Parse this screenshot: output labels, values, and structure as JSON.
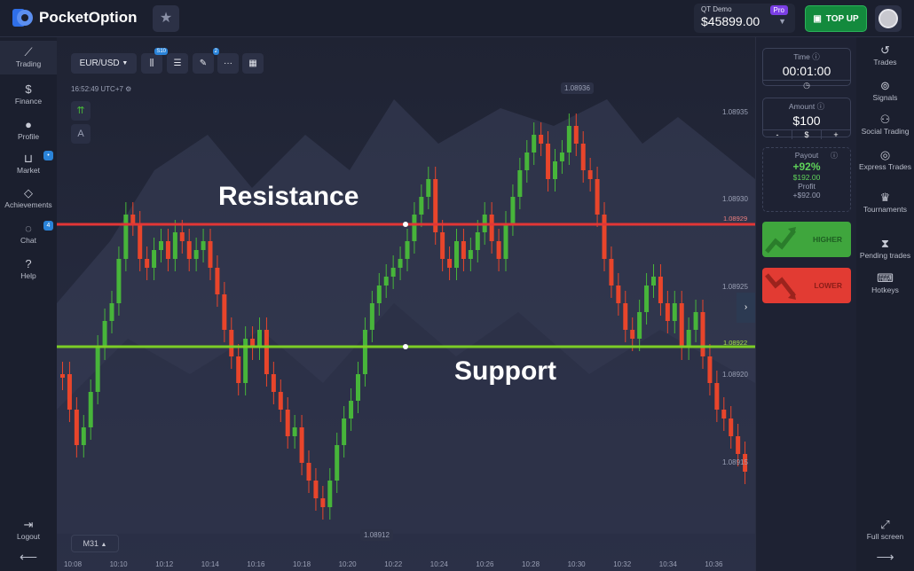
{
  "brand": {
    "name": "PocketOption"
  },
  "account": {
    "label": "QT Demo",
    "balance": "$45899.00",
    "badge": "Pro",
    "topup": "TOP UP"
  },
  "left_nav": [
    {
      "label": "Trading",
      "icon": "chart-line-icon",
      "badge": ""
    },
    {
      "label": "Finance",
      "icon": "dollar-icon",
      "badge": ""
    },
    {
      "label": "Profile",
      "icon": "user-icon",
      "badge": ""
    },
    {
      "label": "Market",
      "icon": "cart-icon",
      "badge": "•"
    },
    {
      "label": "Achievements",
      "icon": "diamond-icon",
      "badge": ""
    },
    {
      "label": "Chat",
      "icon": "chat-icon",
      "badge": "4"
    },
    {
      "label": "Help",
      "icon": "help-icon",
      "badge": ""
    }
  ],
  "left_bottom": {
    "logout": "Logout"
  },
  "right_nav": [
    {
      "label": "Trades",
      "icon": "history-icon"
    },
    {
      "label": "Signals",
      "icon": "signal-icon"
    },
    {
      "label": "Social Trading",
      "icon": "users-icon"
    },
    {
      "label": "Express Trades",
      "icon": "express-icon"
    },
    {
      "label": "Tournaments",
      "icon": "trophy-icon"
    },
    {
      "label": "Pending trades",
      "icon": "hourglass-icon"
    },
    {
      "label": "Hotkeys",
      "icon": "keyboard-icon"
    }
  ],
  "right_bottom": {
    "fullscreen": "Full screen"
  },
  "toolbar": {
    "pair": "EUR/USD",
    "indicator_badge": "S10",
    "draw_badge": "2"
  },
  "chart_info": {
    "clock": "16:52:49",
    "tz": "UTC+7",
    "timeframe": "M31"
  },
  "annotations": {
    "resistance": "Resistance",
    "support": "Support"
  },
  "levels": {
    "resistance_label": "1.08929",
    "support_label": "1.08922"
  },
  "price_axis": [
    "1.08935",
    "1.08930",
    "1.08925",
    "1.08920",
    "1.08915"
  ],
  "extremes": {
    "high": "1.08936",
    "low": "1.08912"
  },
  "time_axis": [
    "10:08",
    "10:10",
    "10:12",
    "10:14",
    "10:16",
    "10:18",
    "10:20",
    "10:22",
    "10:24",
    "10:26",
    "10:28",
    "10:30",
    "10:32",
    "10:34",
    "10:36"
  ],
  "trade_panel": {
    "time_title": "Time",
    "time_value": "00:01:00",
    "amount_title": "Amount",
    "amount_value": "$100",
    "minus": "-",
    "currency": "$",
    "plus": "+",
    "payout_title": "Payout",
    "payout_percent": "+92%",
    "payout_total": "$192.00",
    "profit_title": "Profit",
    "profit_value": "+$92.00",
    "higher": "HIGHER",
    "lower": "LOWER"
  },
  "colors": {
    "bull": "#47b53a",
    "bear": "#e8452b",
    "resistance": "#e23636",
    "support": "#7ccd26"
  },
  "chart_data": {
    "type": "candlestick",
    "ylim": [
      1.089115,
      1.089365
    ],
    "resistance": 1.08929,
    "support": 1.08922
  }
}
